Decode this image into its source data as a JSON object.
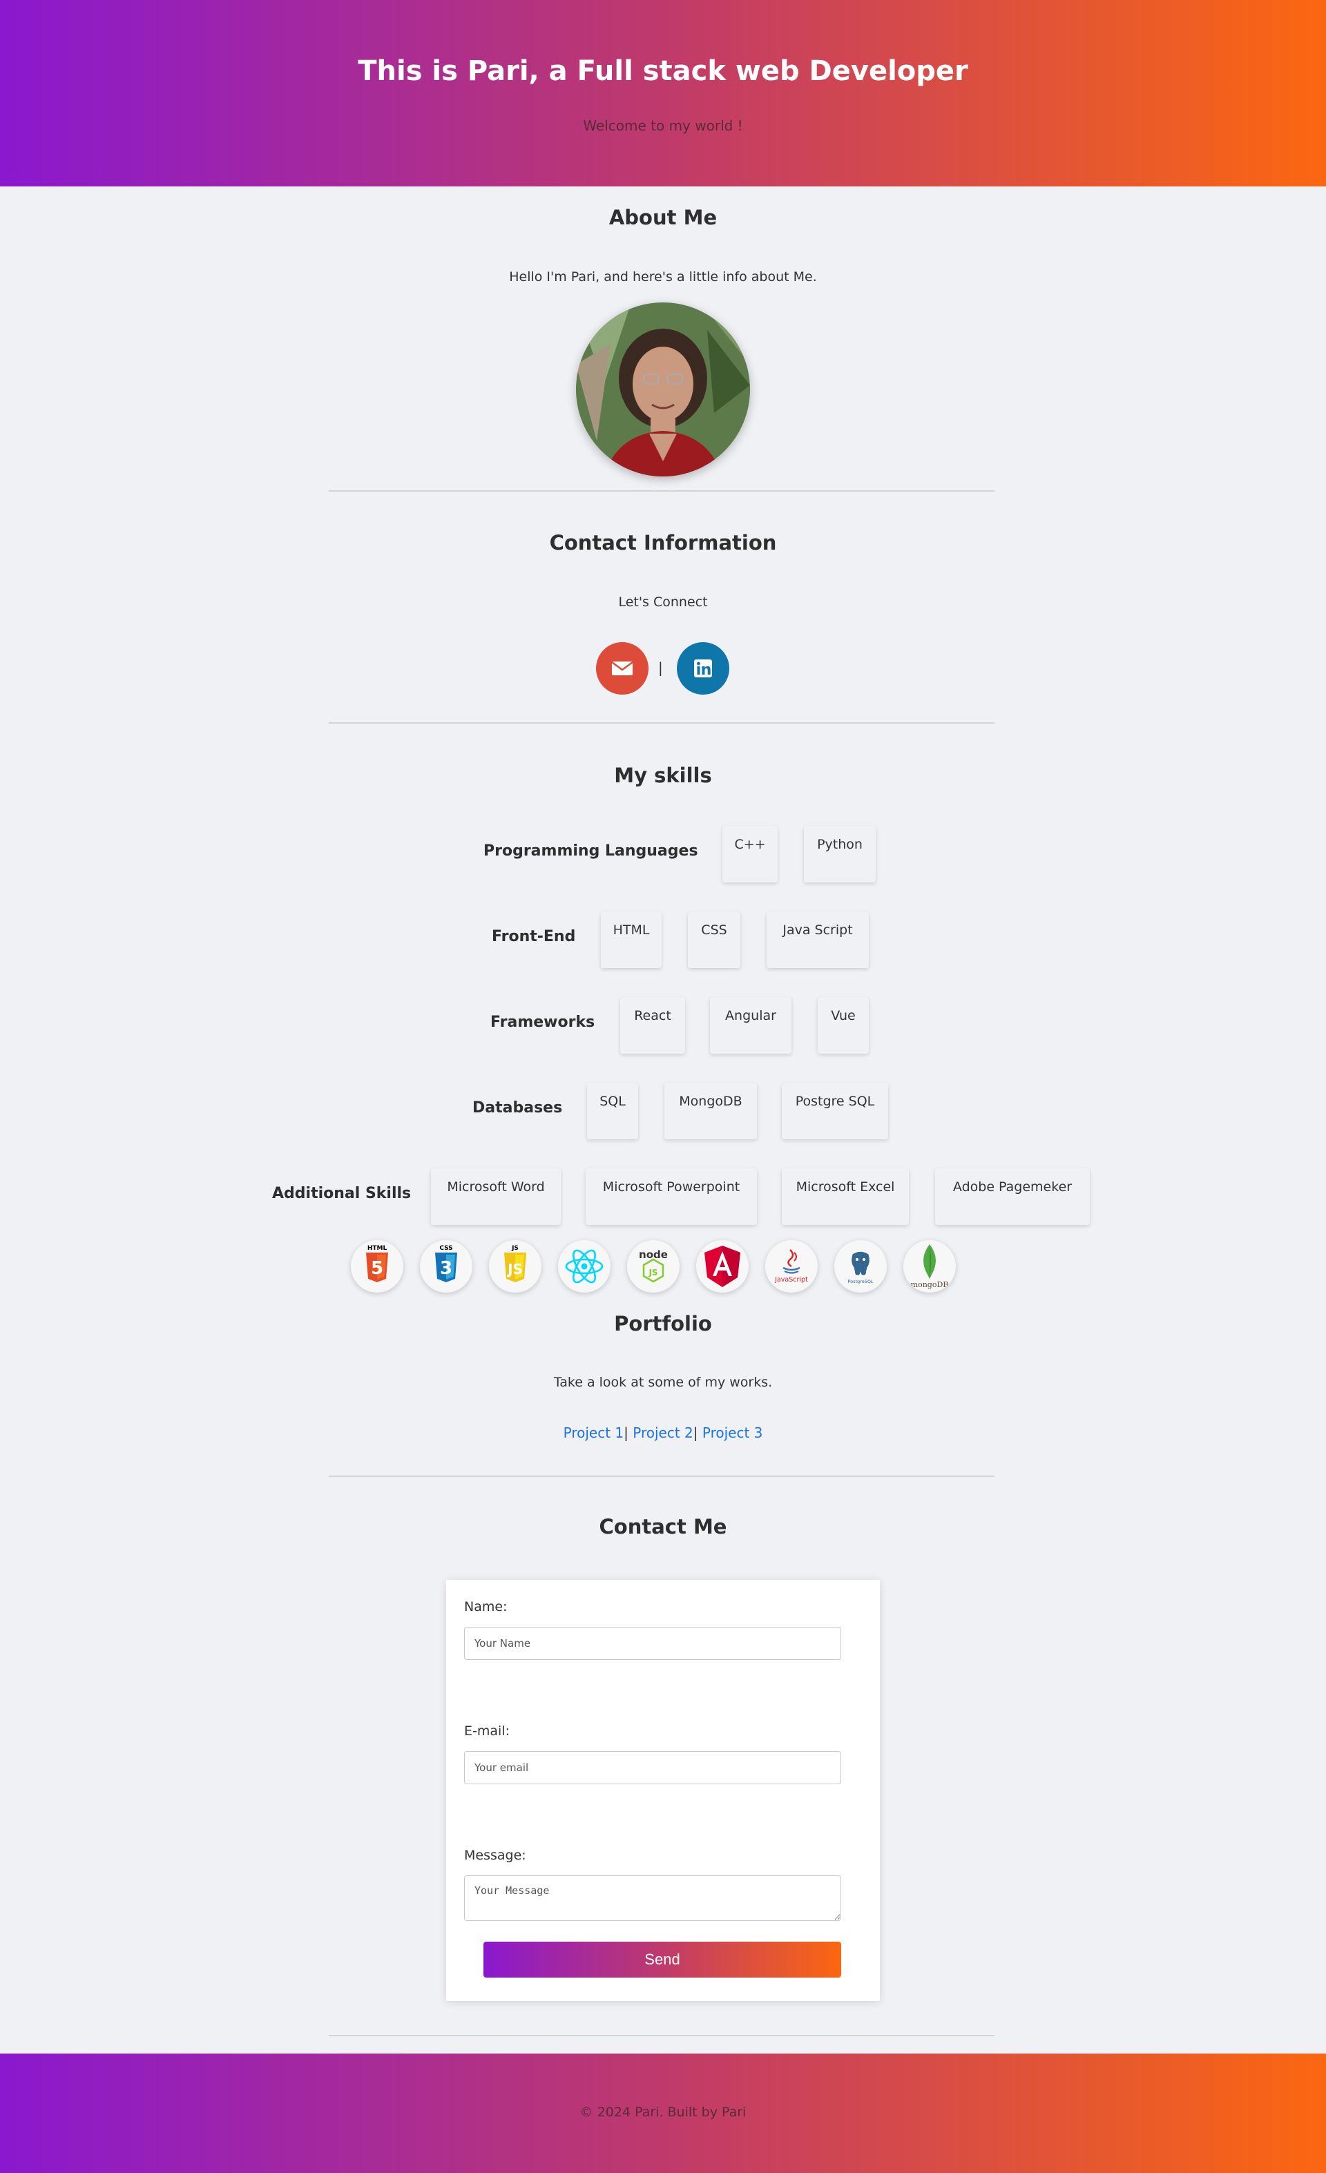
{
  "header": {
    "title": "This is Pari, a Full stack web Developer",
    "tagline": "Welcome to my world !"
  },
  "about": {
    "title": "About Me",
    "intro": "Hello I'm Pari, and here's a little info about Me."
  },
  "contact_info": {
    "title": "Contact Information",
    "subtitle": "Let's Connect",
    "separator": "|",
    "links": [
      {
        "icon": "envelope-icon",
        "color": "#dd4b39"
      },
      {
        "icon": "linkedin-icon",
        "color": "#0e76a8"
      }
    ]
  },
  "skills": {
    "title": "My skills",
    "groups": [
      {
        "label": "Programming Languages",
        "items": [
          "C++",
          "Python"
        ]
      },
      {
        "label": "Front-End",
        "items": [
          "HTML",
          "CSS",
          "Java Script"
        ]
      },
      {
        "label": "Frameworks",
        "items": [
          "React",
          "Angular",
          "Vue"
        ]
      },
      {
        "label": "Databases",
        "items": [
          "SQL",
          "MongoDB",
          "Postgre SQL"
        ]
      },
      {
        "label": "Additional Skills",
        "items": [
          "Microsoft Word",
          "Microsoft Powerpoint",
          "Microsoft Excel",
          "Adobe Pagemeker"
        ]
      }
    ],
    "tech_icons": [
      {
        "icon": "html5-icon",
        "text": "HTML",
        "color": "#e44d26"
      },
      {
        "icon": "css3-icon",
        "text": "CSS",
        "color": "#1572b6"
      },
      {
        "icon": "javascript-icon",
        "text": "JS",
        "color": "#f7df1e"
      },
      {
        "icon": "react-icon",
        "color": "#00d8ff"
      },
      {
        "icon": "nodejs-icon",
        "text": "node",
        "color": "#83cd29"
      },
      {
        "icon": "angular-icon",
        "color": "#dd0031"
      },
      {
        "icon": "java-icon",
        "text": "JavaScript",
        "color": "#e11f21"
      },
      {
        "icon": "postgresql-icon",
        "text": "PostgreSQL",
        "color": "#336791"
      },
      {
        "icon": "mongodb-icon",
        "text": "mongoDB",
        "color": "#4faa41"
      }
    ]
  },
  "portfolio": {
    "title": "Portfolio",
    "subtitle": "Take a look at some of my works.",
    "projects": [
      "Project 1",
      "Project 2",
      "Project 3"
    ],
    "separator": "|"
  },
  "contact_form": {
    "title": "Contact Me",
    "name_label": "Name:",
    "name_placeholder": "Your Name",
    "email_label": "E-mail:",
    "email_placeholder": "Your email",
    "message_label": "Message:",
    "message_placeholder": "Your Message",
    "send_label": "Send"
  },
  "footer": {
    "copyright": "© 2024 Pari. Built by Pari"
  }
}
